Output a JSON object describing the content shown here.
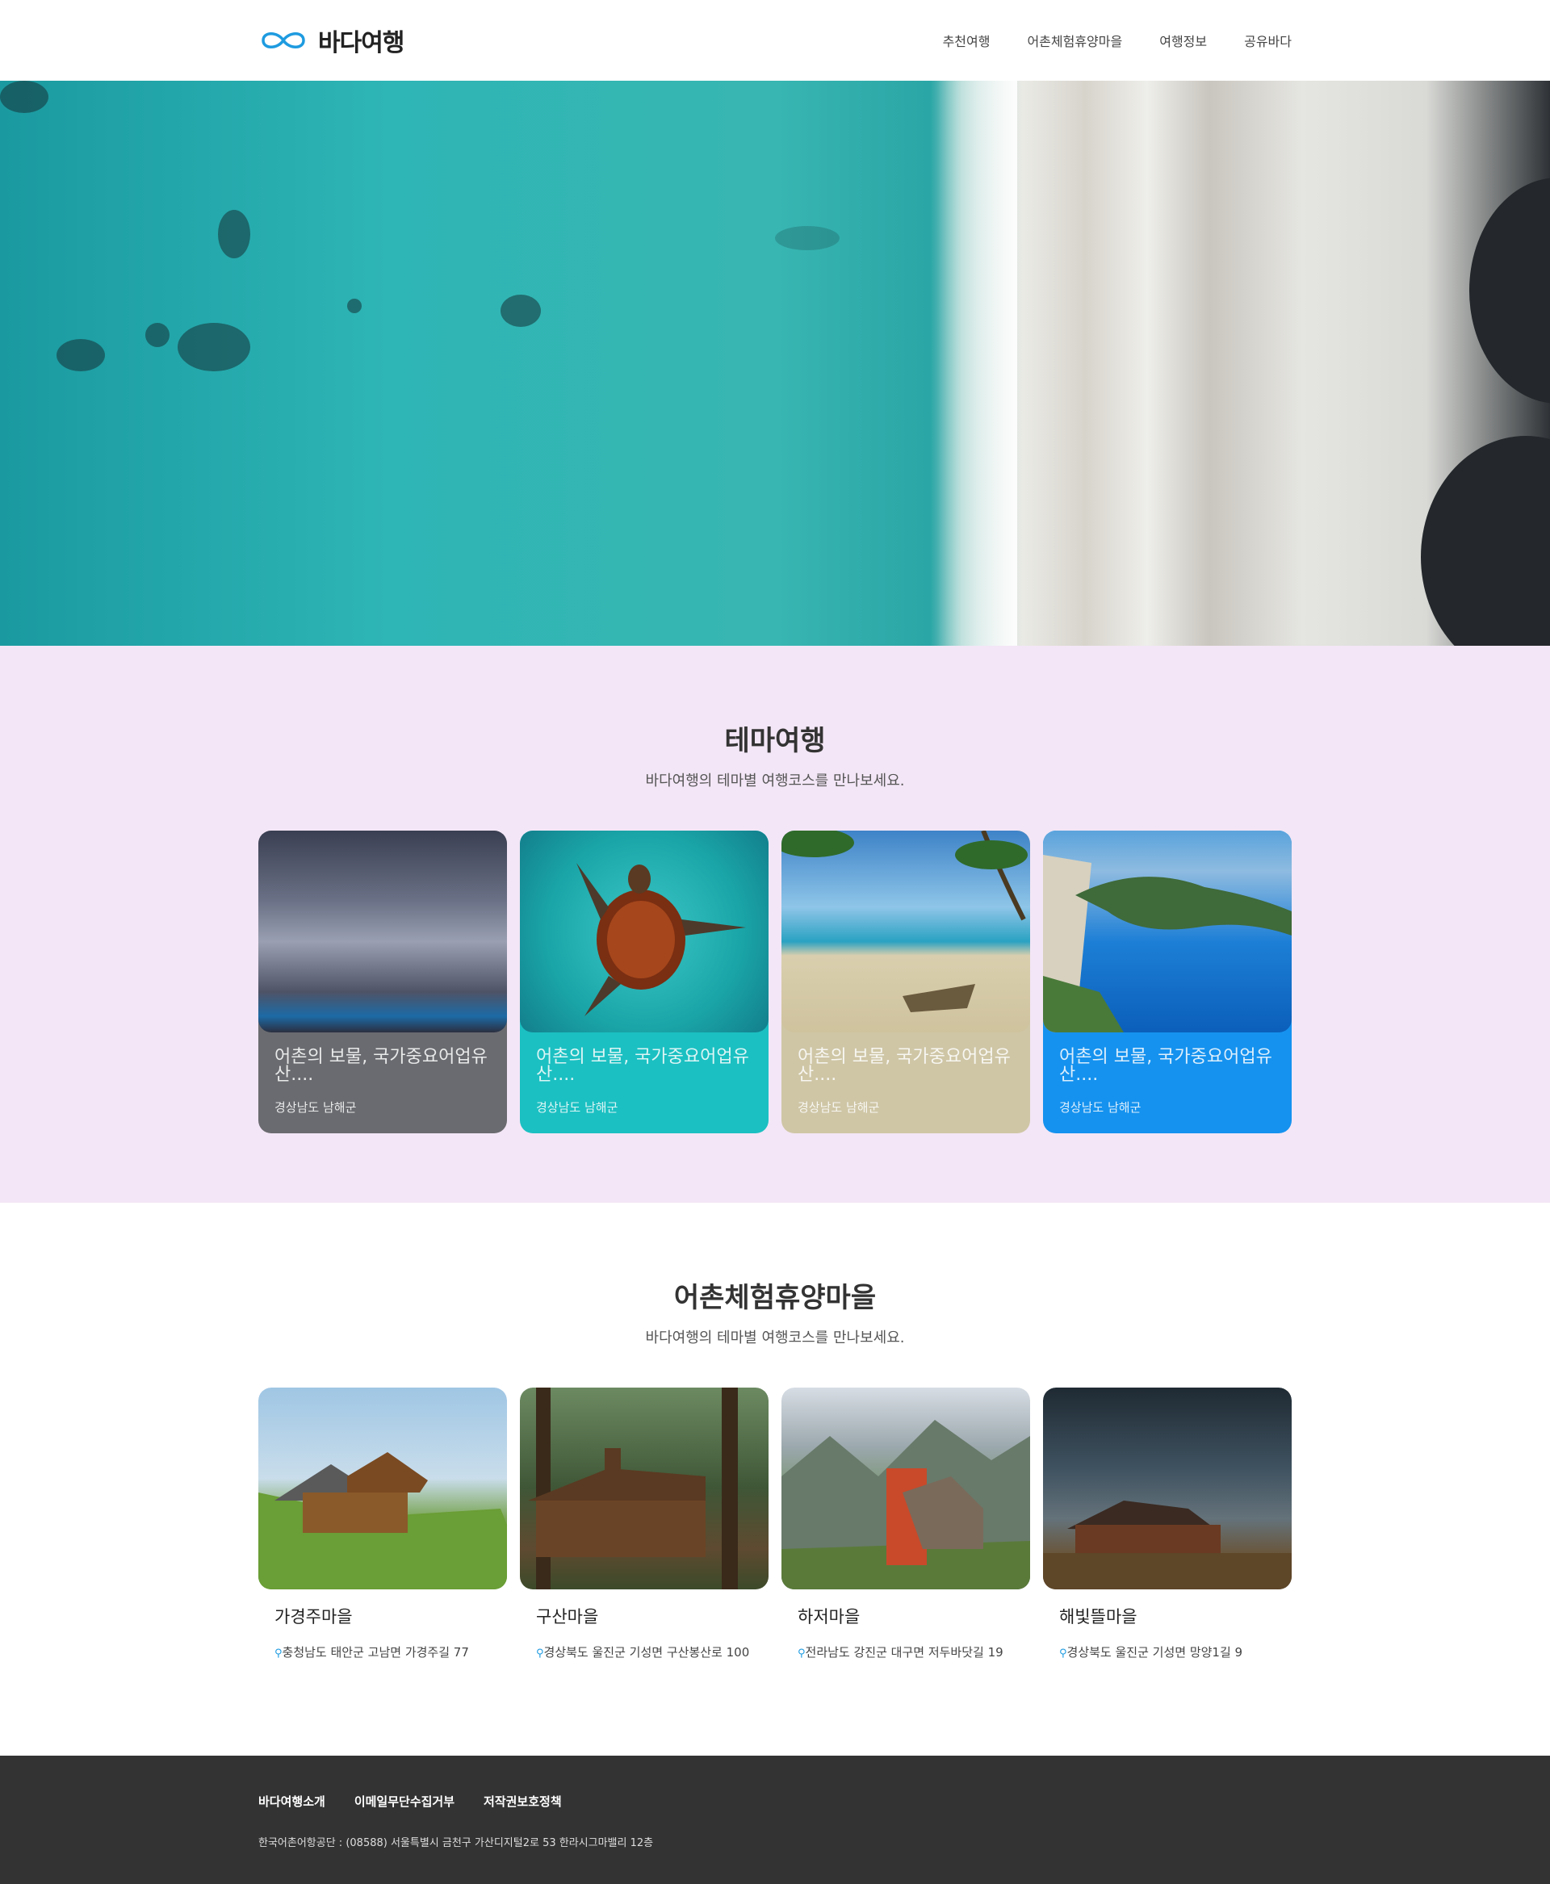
{
  "header": {
    "logo_text": "바다여행",
    "nav": [
      {
        "label": "추천여행"
      },
      {
        "label": "어촌체험휴양마을"
      },
      {
        "label": "여행정보"
      },
      {
        "label": "공유바다"
      }
    ]
  },
  "theme": {
    "title": "테마여행",
    "subtitle": "바다여행의 테마별 여행코스를 만나보세요.",
    "cards": [
      {
        "title": "어촌의 보물, 국가중요어업유산....",
        "location": "경상남도 남해군",
        "color": "#6a6b70"
      },
      {
        "title": "어촌의 보물, 국가중요어업유산....",
        "location": "경상남도 남해군",
        "color": "#1bc0c2"
      },
      {
        "title": "어촌의 보물, 국가중요어업유산....",
        "location": "경상남도 남해군",
        "color": "#cfc6a6"
      },
      {
        "title": "어촌의 보물, 국가중요어업유산....",
        "location": "경상남도 남해군",
        "color": "#1592ef"
      }
    ]
  },
  "village": {
    "title": "어촌체험휴양마을",
    "subtitle": "바다여행의 테마별 여행코스를 만나보세요.",
    "cards": [
      {
        "title": "가경주마을",
        "address": "충청남도 태안군 고남면 가경주길 77"
      },
      {
        "title": "구산마을",
        "address": "경상북도 울진군 기성면 구산봉산로 100"
      },
      {
        "title": "하저마을",
        "address": "전라남도 강진군 대구면 저두바닷길 19"
      },
      {
        "title": "해빛뜰마을",
        "address": "경상북도 울진군 기성면 망양1길 9"
      }
    ]
  },
  "footer": {
    "links": [
      {
        "label": "바다여행소개"
      },
      {
        "label": "이메일무단수집거부"
      },
      {
        "label": "저작권보호정책"
      }
    ],
    "address": "한국어촌어항공단 : (08588) 서울특별시 금천구 가산디지털2로 53 한라시그마밸리 12층"
  },
  "colors": {
    "brand_blue": "#1e9be0",
    "theme_bg": "#f3e6f6",
    "footer_bg": "#333333"
  }
}
